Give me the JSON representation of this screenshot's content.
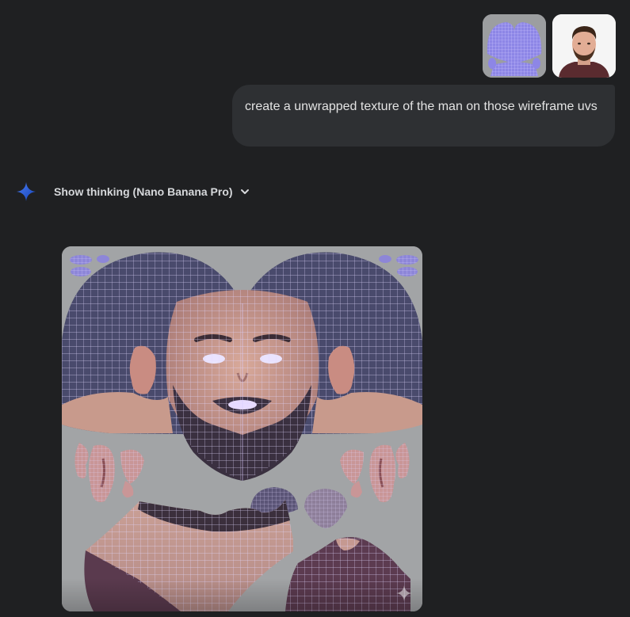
{
  "conversation": {
    "attachments": [
      {
        "name": "uv wireframe attachment",
        "icon": "uv-wireframe-thumbnail"
      },
      {
        "name": "man portrait attachment",
        "icon": "portrait-photo-thumbnail"
      }
    ],
    "user_message": "create a unwrapped texture of the man on those wireframe uvs",
    "model_response": {
      "thinking_label": "Show thinking (Nano Banana Pro)",
      "icon": "sparkle-icon",
      "expand_icon": "chevron-down-icon",
      "image": {
        "description_icon": "generated-uv-texture",
        "watermark_icon": "sparkle-watermark-icon"
      }
    }
  },
  "colors": {
    "background": "#1f2022",
    "bubble": "#2e3033",
    "text": "#e3e3e3",
    "accent_blue": "#1a4fd6",
    "uv_gray": "#a2a4a6",
    "wire_lavender": "#d8ccff"
  }
}
